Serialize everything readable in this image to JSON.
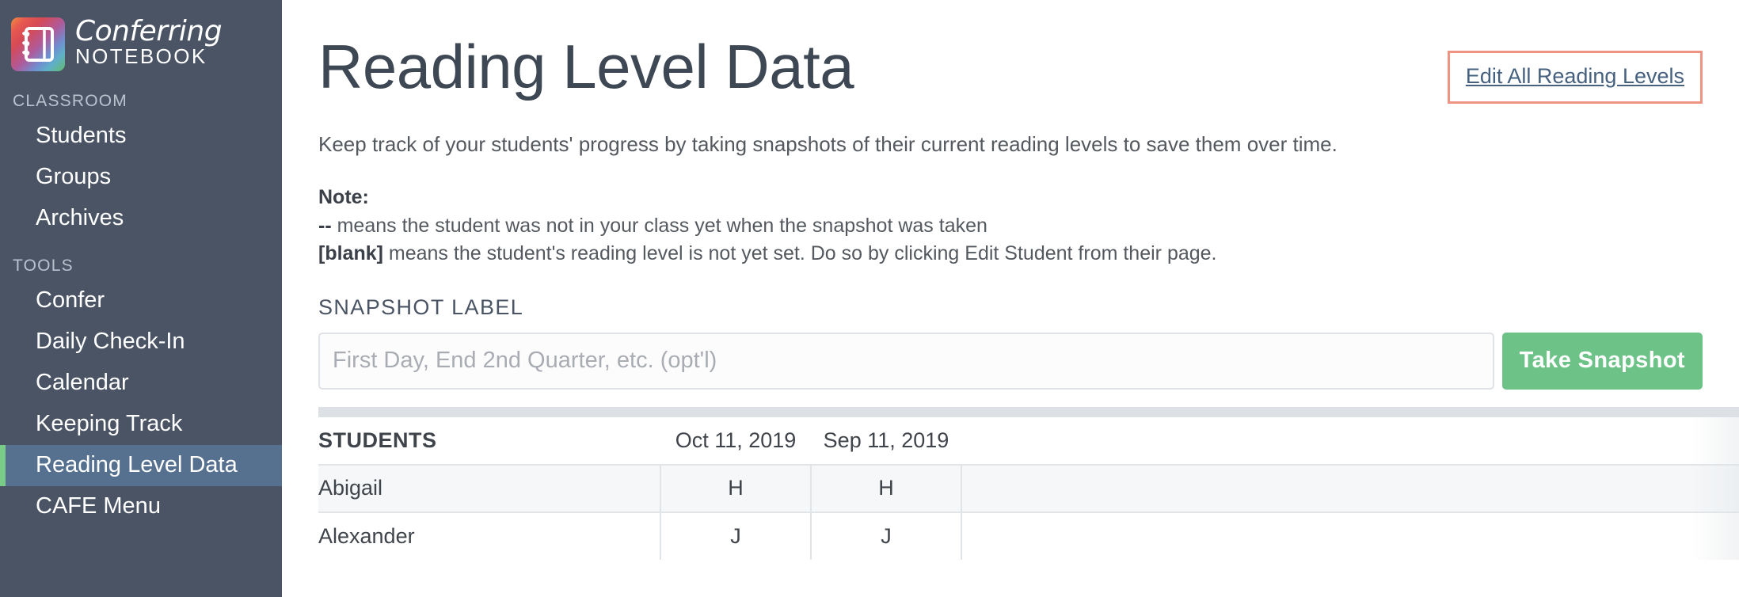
{
  "brand": {
    "name": "Conferring",
    "subtitle": "NOTEBOOK",
    "logo_icon": "notebook-icon"
  },
  "sidebar": {
    "sections": [
      {
        "label": "CLASSROOM",
        "items": [
          {
            "label": "Students",
            "active": false
          },
          {
            "label": "Groups",
            "active": false
          },
          {
            "label": "Archives",
            "active": false
          }
        ]
      },
      {
        "label": "TOOLS",
        "items": [
          {
            "label": "Confer",
            "active": false
          },
          {
            "label": "Daily Check-In",
            "active": false
          },
          {
            "label": "Calendar",
            "active": false
          },
          {
            "label": "Keeping Track",
            "active": false
          },
          {
            "label": "Reading Level Data",
            "active": true
          },
          {
            "label": "CAFE Menu",
            "active": false
          }
        ]
      }
    ]
  },
  "main": {
    "title": "Reading Level Data",
    "edit_all_link": "Edit All Reading Levels",
    "lede": "Keep track of your students' progress by taking snapshots of their current reading levels to save them over time.",
    "note": {
      "title": "Note:",
      "line1_marker": "--",
      "line1_text": " means the student was not in your class yet when the snapshot was taken",
      "line2_marker": "[blank]",
      "line2_text": " means the student's reading level is not yet set. Do so by clicking Edit Student from their page."
    },
    "snapshot": {
      "field_label": "SNAPSHOT LABEL",
      "input_value": "",
      "input_placeholder": "First Day, End 2nd Quarter, etc. (opt'l)",
      "button_label": "Take Snapshot"
    },
    "table": {
      "students_header": "STUDENTS",
      "date_columns": [
        "Oct 11, 2019",
        "Sep 11, 2019"
      ],
      "rows": [
        {
          "name": "Abigail",
          "levels": [
            "H",
            "H"
          ]
        },
        {
          "name": "Alexander",
          "levels": [
            "J",
            "J"
          ]
        }
      ]
    }
  },
  "colors": {
    "sidebar_bg": "#4a5464",
    "sidebar_active_bg": "#56718f",
    "sidebar_active_accent": "#79cc87",
    "accent_green": "#6cc287",
    "highlight_border": "#ef9483",
    "link_blue": "#4f7296",
    "text_dark": "#3b4048"
  }
}
